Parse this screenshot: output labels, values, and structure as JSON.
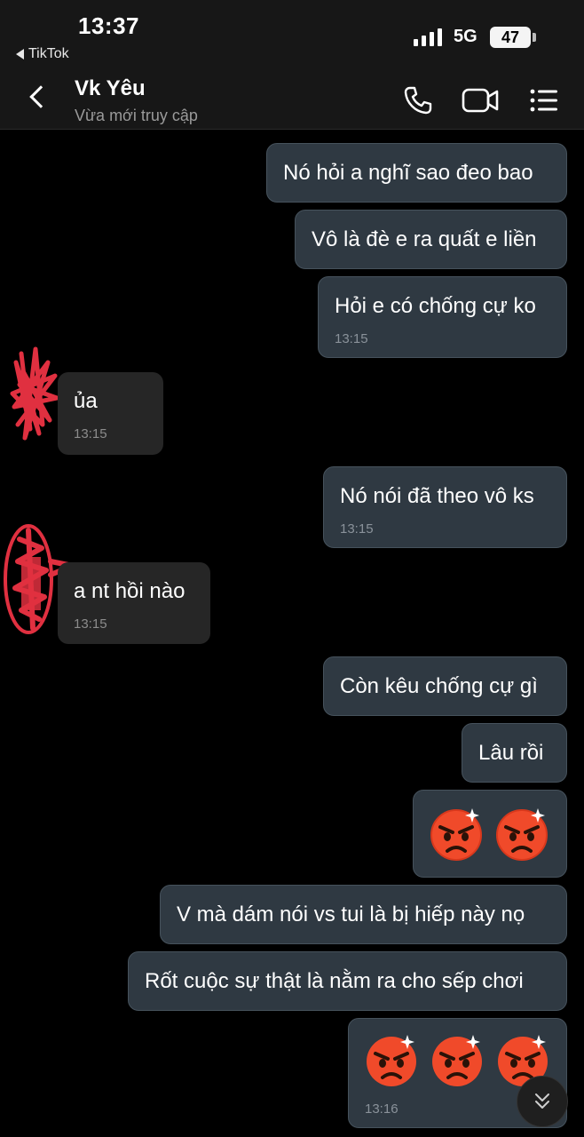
{
  "status_bar": {
    "time": "13:37",
    "back_app": "TikTok",
    "network": "5G",
    "battery": "47"
  },
  "header": {
    "contact_name": "Vk Yêu",
    "contact_status": "Vừa mới truy cập"
  },
  "messages": [
    {
      "direction": "out",
      "text": "Nó hỏi a nghĩ sao đeo bao"
    },
    {
      "direction": "out",
      "text": "Vô là đè e ra quất e liền"
    },
    {
      "direction": "out",
      "text": "Hỏi e có chống cự ko",
      "time": "13:15"
    },
    {
      "direction": "in",
      "text": "ủa",
      "time": "13:15"
    },
    {
      "direction": "out",
      "text": "Nó nói đã theo vô ks",
      "time": "13:15"
    },
    {
      "direction": "in",
      "text": "a nt hồi nào",
      "time": "13:15"
    },
    {
      "direction": "out",
      "text": "Còn kêu chống cự gì"
    },
    {
      "direction": "out",
      "text": "Lâu rồi"
    },
    {
      "direction": "out",
      "emoji": [
        "angry-face",
        "angry-face"
      ]
    },
    {
      "direction": "out",
      "text": "V mà dám nói vs tui là bị hiếp này nọ"
    },
    {
      "direction": "out",
      "text": "Rốt cuộc sự thật là nằm ra cho sếp chơi"
    },
    {
      "direction": "out",
      "emoji": [
        "angry-face",
        "angry-face",
        "angry-face"
      ],
      "time": "13:16"
    }
  ],
  "colors": {
    "header_bg": "#171717",
    "outgoing_bubble": "#2f3942",
    "incoming_bubble": "#262626",
    "scribble": "#e03040"
  },
  "icons": [
    "back-chevron-icon",
    "phone-icon",
    "video-call-icon",
    "menu-icon",
    "scroll-down-icon"
  ]
}
